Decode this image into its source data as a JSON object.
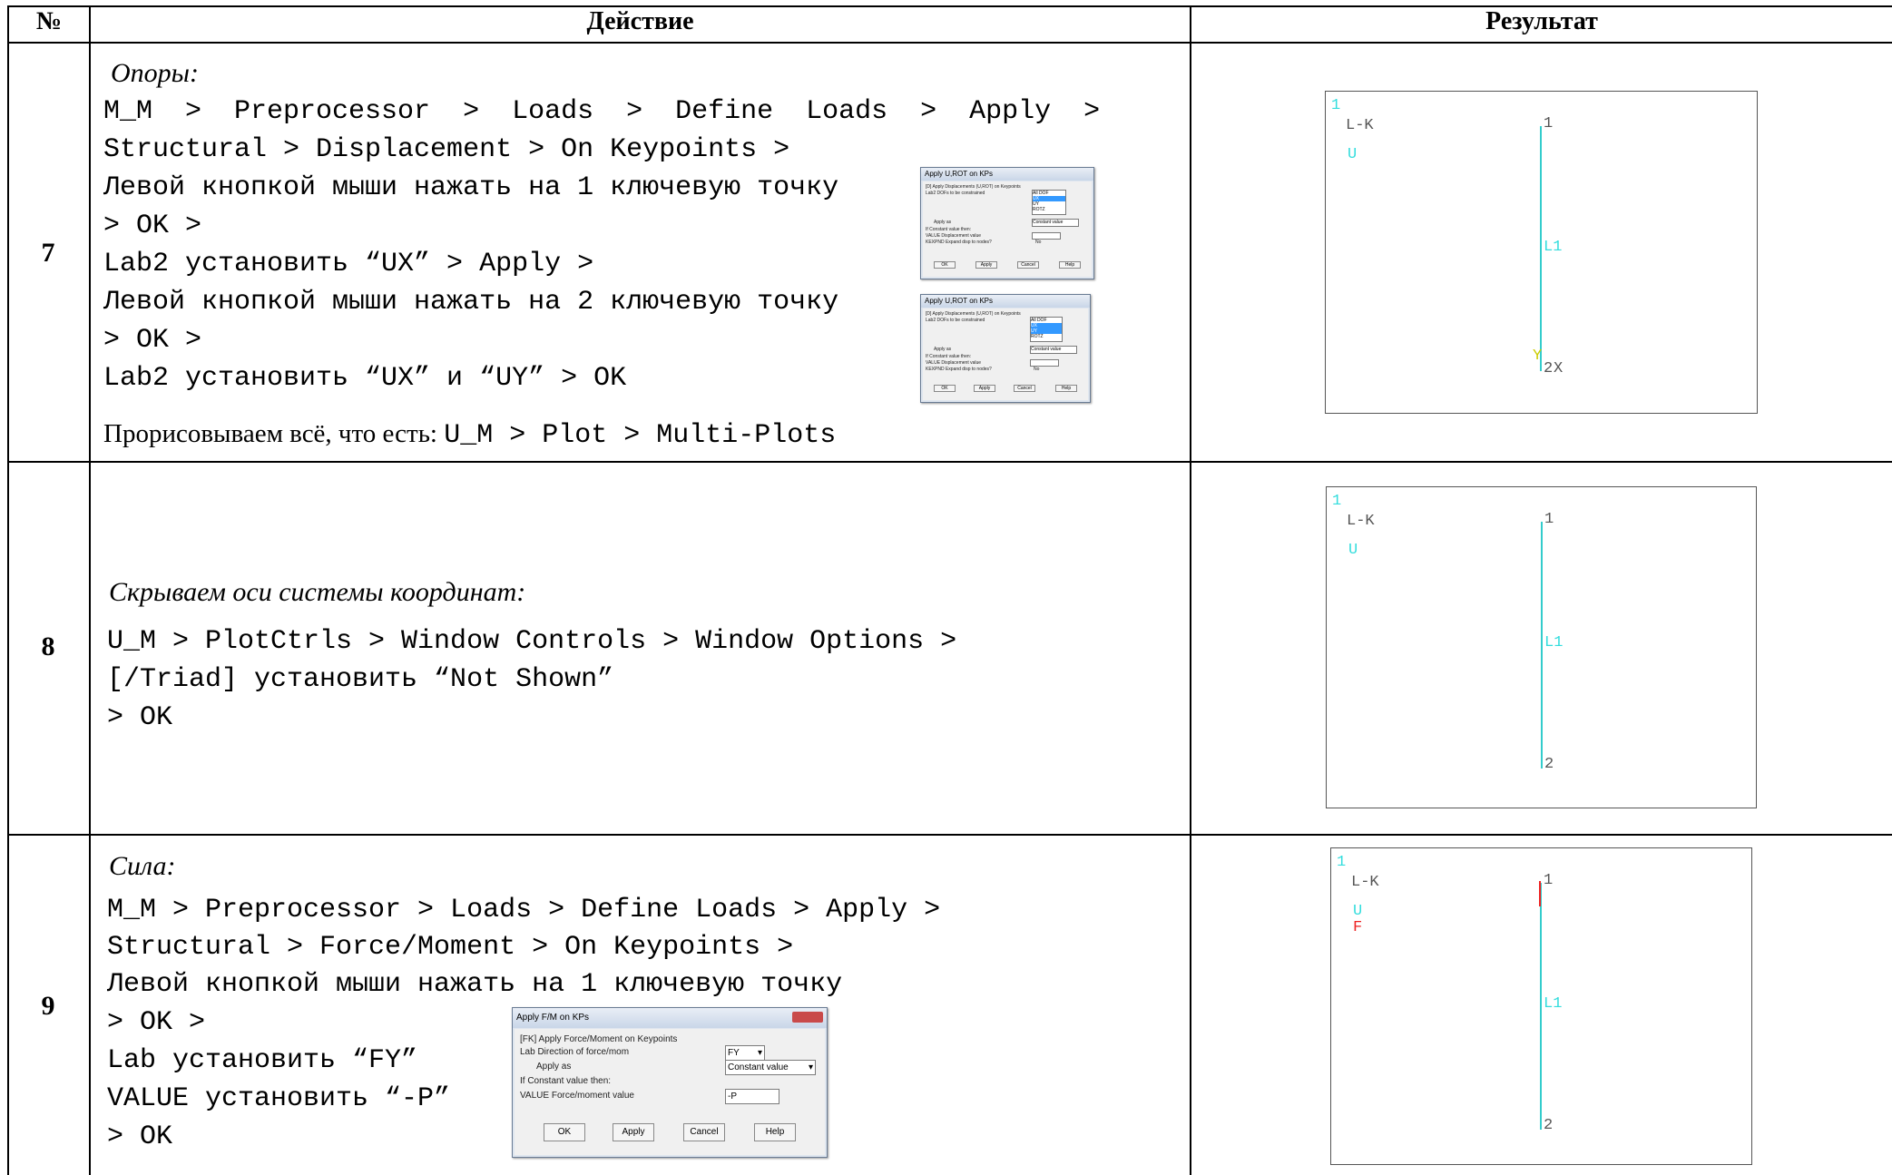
{
  "header": {
    "num": "№",
    "action": "Действие",
    "result": "Результат"
  },
  "rows": [
    {
      "num": "7",
      "title": "Опоры:",
      "lines": [
        "M_M  >  Preprocessor  >  Loads  >  Define  Loads  >  Apply  >",
        "Structural > Displacement > On Keypoints >",
        "Левой кнопкой мыши нажать на 1 ключевую точку",
        "> OK >",
        "Lab2 установить “UX” > Apply >",
        "Левой кнопкой мыши нажать на 2 ключевую точку",
        "> OK >",
        "Lab2 установить “UX” и “UY” > OK"
      ],
      "footer_serif": "Прорисовываем всё, что есть: ",
      "footer_mono": "U_M > Plot > Multi-Plots",
      "plot": {
        "corner": "1",
        "lk": "L-K",
        "legend1": "U",
        "kp1": "1",
        "line": "L1",
        "kp2": "2",
        "axis": "X",
        "axis_y": "Y"
      }
    },
    {
      "num": "8",
      "title": "Скрываем оси системы координат:",
      "lines": [
        "U_M > PlotCtrls > Window Controls > Window Options >",
        "[/Triad] установить “Not Shown”",
        "> OK"
      ],
      "plot": {
        "corner": "1",
        "lk": "L-K",
        "legend1": "U",
        "kp1": "1",
        "line": "L1",
        "kp2": "2"
      }
    },
    {
      "num": "9",
      "title": "Сила:",
      "lines": [
        "M_M > Preprocessor > Loads > Define Loads > Apply >",
        "Structural > Force/Moment > On Keypoints >",
        "Левой кнопкой мыши нажать на 1 ключевую точку",
        "> OK >",
        "Lab установить “FY”",
        "VALUE установить “-P”",
        "> OK"
      ],
      "plot": {
        "corner": "1",
        "lk": "L-K",
        "legend1": "U",
        "legend2": "F",
        "kp1": "1",
        "line": "L1",
        "kp2": "2"
      }
    }
  ],
  "dialog_small": {
    "title": "Apply U,ROT on KPs",
    "heading": "[D] Apply Displacements (U,ROT) on Keypoints",
    "lab2": "Lab2  DOFs to be constrained",
    "options": [
      "All DOF",
      "UX",
      "UY",
      "ROTZ"
    ],
    "apply_as": "Apply as",
    "apply_value": "Constant value",
    "if_const": "If Constant value then:",
    "value": "VALUE  Displacement value",
    "kexpnd": "KEXPND  Expand disp to nodes?",
    "no": "No",
    "ok": "OK",
    "apply": "Apply",
    "cancel": "Cancel",
    "help": "Help"
  },
  "dialog_force": {
    "title": "Apply F/M on KPs",
    "heading": "[FK]  Apply Force/Moment on Keypoints",
    "lab": "Lab    Direction of force/mom",
    "lab_value": "FY",
    "apply_as": "Apply as",
    "apply_value": "Constant value",
    "if_const": "If Constant value then:",
    "value": "VALUE  Force/moment value",
    "value_value": "-P",
    "ok": "OK",
    "apply": "Apply",
    "cancel": "Cancel",
    "help": "Help"
  },
  "colors": {
    "beam": "#33cccc",
    "force": "#ee2222",
    "border": "#000000"
  }
}
